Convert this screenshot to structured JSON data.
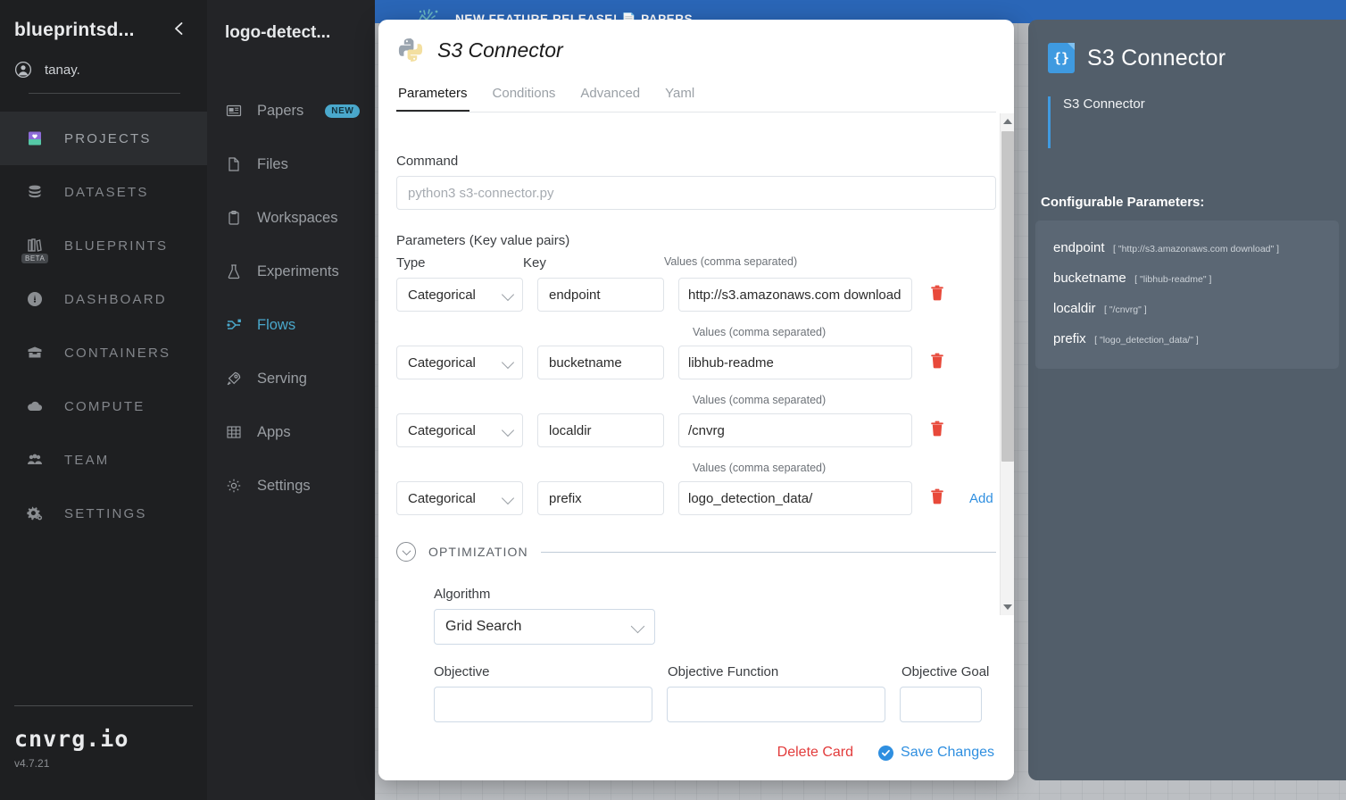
{
  "banner": {
    "text": "NEW FEATURE RELEASE! 📄 PAPERS"
  },
  "sidebar": {
    "org": "blueprintsd...",
    "user": "tanay.",
    "collapse_icon": "chevron-left-icon",
    "items": [
      {
        "label": "PROJECTS",
        "icon": "projects-icon",
        "active": true,
        "badge": ""
      },
      {
        "label": "DATASETS",
        "icon": "datasets-icon",
        "active": false,
        "badge": ""
      },
      {
        "label": "BLUEPRINTS",
        "icon": "blueprints-icon",
        "active": false,
        "badge": "BETA"
      },
      {
        "label": "DASHBOARD",
        "icon": "dashboard-icon",
        "active": false,
        "badge": ""
      },
      {
        "label": "CONTAINERS",
        "icon": "containers-icon",
        "active": false,
        "badge": ""
      },
      {
        "label": "COMPUTE",
        "icon": "compute-icon",
        "active": false,
        "badge": ""
      },
      {
        "label": "TEAM",
        "icon": "team-icon",
        "active": false,
        "badge": ""
      },
      {
        "label": "SETTINGS",
        "icon": "settings-icon",
        "active": false,
        "badge": ""
      }
    ],
    "brand": "cnvrg.io",
    "version": "v4.7.21"
  },
  "project_sidebar": {
    "title": "logo-detect...",
    "items": [
      {
        "label": "Papers",
        "icon": "papers-icon",
        "active": false,
        "badge": "NEW"
      },
      {
        "label": "Files",
        "icon": "file-icon",
        "active": false,
        "badge": ""
      },
      {
        "label": "Workspaces",
        "icon": "clipboard-icon",
        "active": false,
        "badge": ""
      },
      {
        "label": "Experiments",
        "icon": "flask-icon",
        "active": false,
        "badge": ""
      },
      {
        "label": "Flows",
        "icon": "flow-icon",
        "active": true,
        "badge": ""
      },
      {
        "label": "Serving",
        "icon": "rocket-icon",
        "active": false,
        "badge": ""
      },
      {
        "label": "Apps",
        "icon": "grid-icon",
        "active": false,
        "badge": ""
      },
      {
        "label": "Settings",
        "icon": "gear-icon",
        "active": false,
        "badge": ""
      }
    ]
  },
  "modal": {
    "icon": "python-icon",
    "title": "S3 Connector",
    "tabs": [
      {
        "label": "Parameters",
        "active": true
      },
      {
        "label": "Conditions",
        "active": false
      },
      {
        "label": "Advanced",
        "active": false
      },
      {
        "label": "Yaml",
        "active": false
      }
    ],
    "command": {
      "label": "Command",
      "value": "",
      "placeholder": "python3 s3-connector.py"
    },
    "parameters": {
      "section_label": "Parameters (Key value pairs)",
      "col_type": "Type",
      "col_key": "Key",
      "col_values": "Values (comma separated)",
      "add_label": "Add",
      "delete_icon": "trash-icon",
      "rows": [
        {
          "type": "Categorical",
          "key": "endpoint",
          "values": "http://s3.amazonaws.com download"
        },
        {
          "type": "Categorical",
          "key": "bucketname",
          "values": "libhub-readme"
        },
        {
          "type": "Categorical",
          "key": "localdir",
          "values": "/cnvrg"
        },
        {
          "type": "Categorical",
          "key": "prefix",
          "values": "logo_detection_data/"
        }
      ]
    },
    "optimization": {
      "title": "OPTIMIZATION",
      "algorithm_label": "Algorithm",
      "algorithm_value": "Grid Search",
      "objective_label": "Objective",
      "objective_value": "",
      "objective_function_label": "Objective Function",
      "objective_function_value": "",
      "objective_goal_label": "Objective Goal",
      "objective_goal_value": ""
    },
    "footer": {
      "delete_label": "Delete Card",
      "save_label": "Save Changes",
      "save_icon": "check-circle-icon"
    }
  },
  "info_panel": {
    "icon": "json-file-icon",
    "title": "S3 Connector",
    "description": "S3 Connector",
    "section_title": "Configurable Parameters:",
    "params": [
      {
        "name": "endpoint",
        "value": "[ \"http://s3.amazonaws.com download\" ]"
      },
      {
        "name": "bucketname",
        "value": "[ \"libhub-readme\" ]"
      },
      {
        "name": "localdir",
        "value": "[ \"/cnvrg\" ]"
      },
      {
        "name": "prefix",
        "value": "[ \"logo_detection_data/\" ]"
      }
    ]
  },
  "colors": {
    "accent_blue": "#2f8fe0",
    "danger_red": "#e23b3b",
    "teal": "#4aa8cc",
    "panel_slate": "#525e6a",
    "banner_blue": "#2a66b7"
  }
}
